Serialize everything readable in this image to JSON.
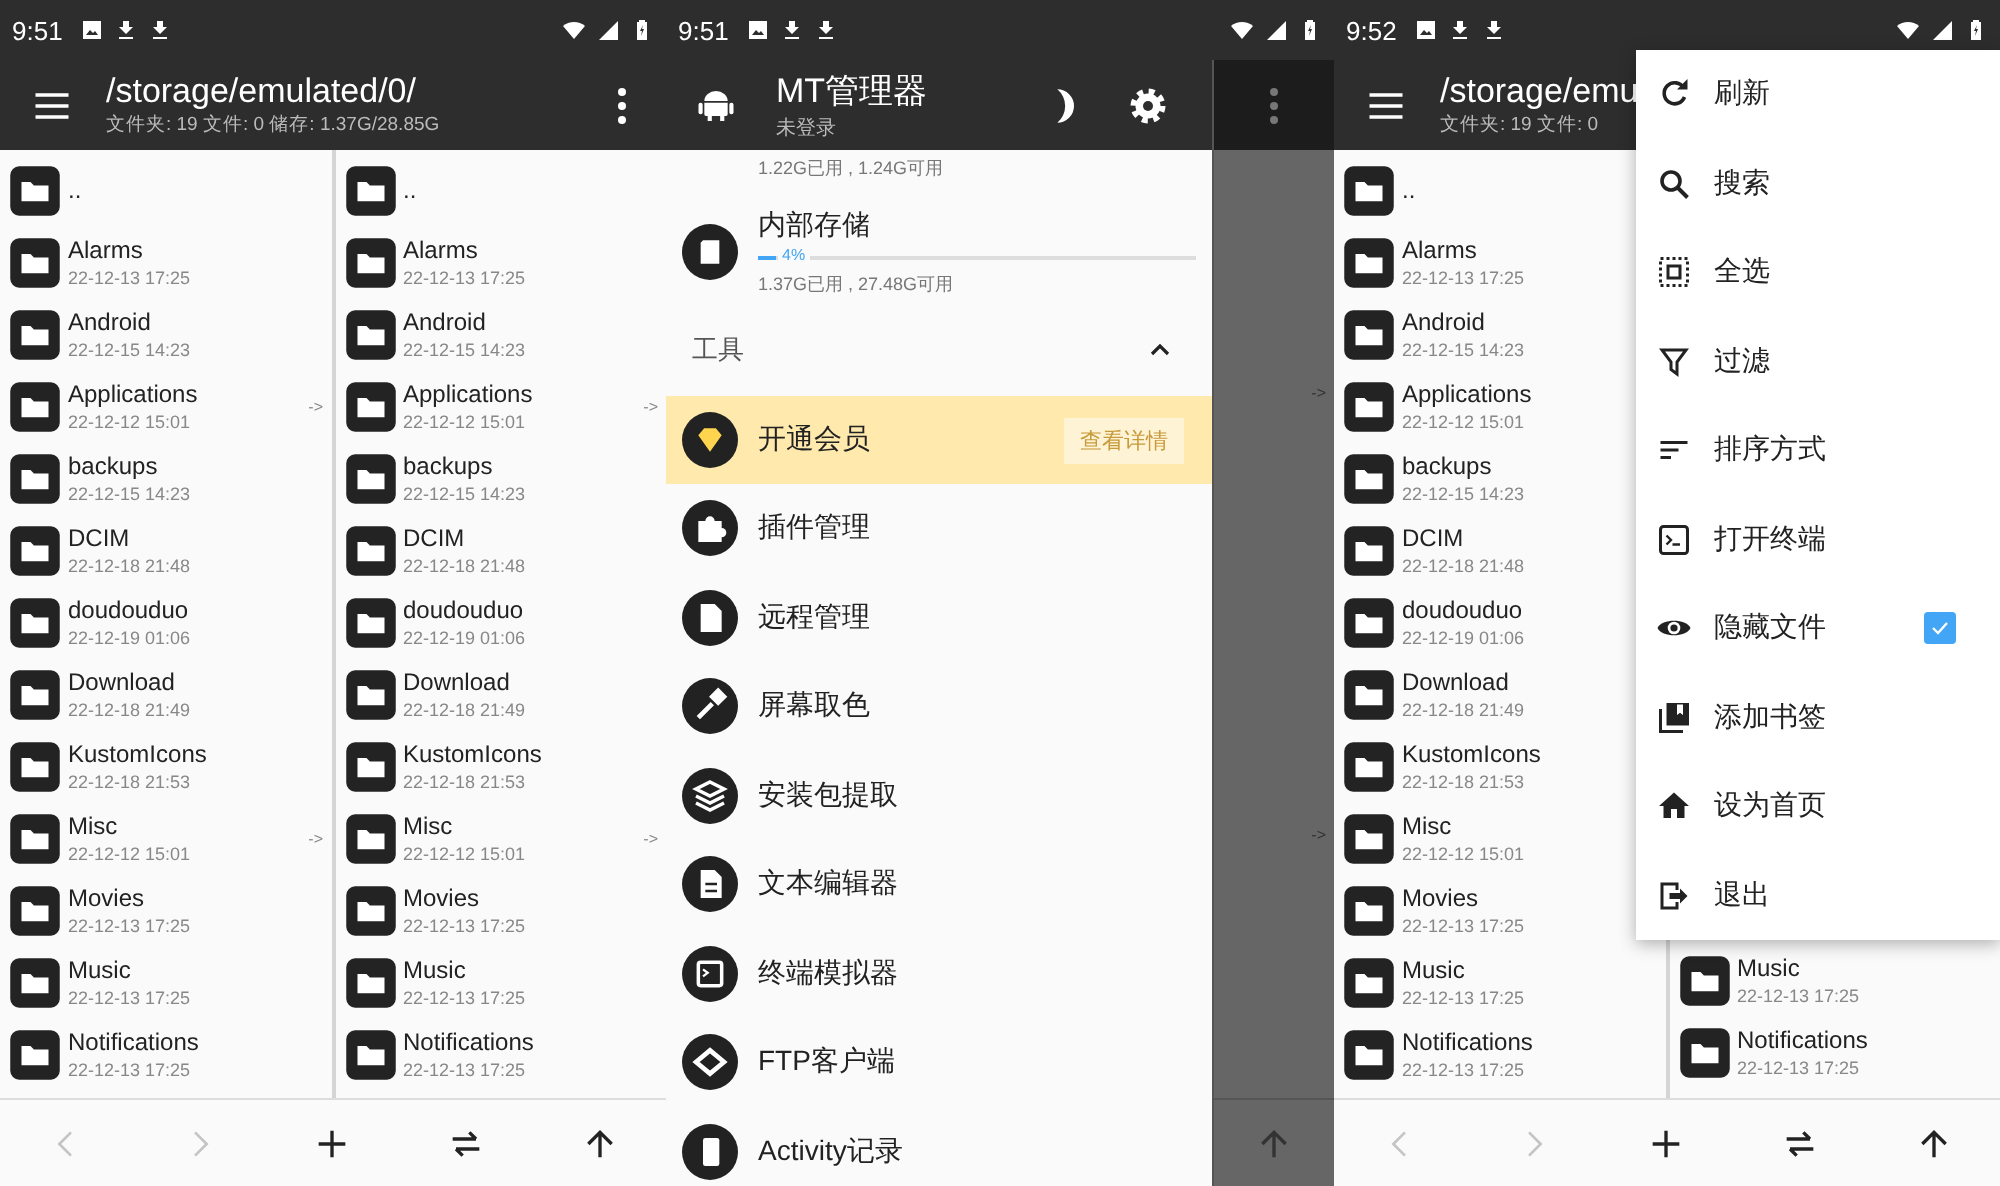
{
  "phones": [
    {
      "kind": "file_manager",
      "status_bar": {
        "time": "9:51"
      },
      "app_bar": {
        "path": "/storage/emulated/0/",
        "info": "文件夹: 19  文件: 0  储存: 1.37G/28.85G"
      },
      "panes": [
        {
          "items": [
            {
              "name": ".."
            },
            {
              "name": "Alarms",
              "date": "22-12-13 17:25"
            },
            {
              "name": "Android",
              "date": "22-12-15 14:23"
            },
            {
              "name": "Applications",
              "date": "22-12-12 15:01",
              "arrow": "->"
            },
            {
              "name": "backups",
              "date": "22-12-15 14:23"
            },
            {
              "name": "DCIM",
              "date": "22-12-18 21:48"
            },
            {
              "name": "doudouduo",
              "date": "22-12-19 01:06"
            },
            {
              "name": "Download",
              "date": "22-12-18 21:49"
            },
            {
              "name": "KustomIcons",
              "date": "22-12-18 21:53"
            },
            {
              "name": "Misc",
              "date": "22-12-12 15:01",
              "arrow": "->"
            },
            {
              "name": "Movies",
              "date": "22-12-13 17:25"
            },
            {
              "name": "Music",
              "date": "22-12-13 17:25"
            },
            {
              "name": "Notifications",
              "date": "22-12-13 17:25"
            }
          ]
        },
        {
          "items": [
            {
              "name": ".."
            },
            {
              "name": "Alarms",
              "date": "22-12-13 17:25"
            },
            {
              "name": "Android",
              "date": "22-12-15 14:23"
            },
            {
              "name": "Applications",
              "date": "22-12-12 15:01",
              "arrow": "->"
            },
            {
              "name": "backups",
              "date": "22-12-15 14:23"
            },
            {
              "name": "DCIM",
              "date": "22-12-18 21:48"
            },
            {
              "name": "doudouduo",
              "date": "22-12-19 01:06"
            },
            {
              "name": "Download",
              "date": "22-12-18 21:49"
            },
            {
              "name": "KustomIcons",
              "date": "22-12-18 21:53"
            },
            {
              "name": "Misc",
              "date": "22-12-12 15:01",
              "arrow": "->"
            },
            {
              "name": "Movies",
              "date": "22-12-13 17:25"
            },
            {
              "name": "Music",
              "date": "22-12-13 17:25"
            },
            {
              "name": "Notifications",
              "date": "22-12-13 17:25"
            }
          ]
        }
      ],
      "bottom_bar": [
        {
          "kind": "back",
          "disabled": true
        },
        {
          "kind": "forward",
          "disabled": true
        },
        {
          "kind": "add",
          "disabled": false
        },
        {
          "kind": "swap",
          "disabled": false
        },
        {
          "kind": "up",
          "disabled": false
        }
      ]
    },
    {
      "kind": "drawer",
      "status_bar": {
        "time": "9:51"
      },
      "header": {
        "title": "MT管理器",
        "subtitle": "未登录"
      },
      "storage": [
        {
          "usage": "1.22G已用 , 1.24G可用"
        },
        {
          "name": "内部存储",
          "percent": "4%",
          "level": 0.04,
          "usage": "1.37G已用 , 27.48G可用"
        }
      ],
      "section": {
        "title": "工具",
        "expanded": true
      },
      "promo": {
        "label": "开通会员",
        "button": "查看详情"
      },
      "tools": [
        {
          "label": "插件管理"
        },
        {
          "label": "远程管理"
        },
        {
          "label": "屏幕取色"
        },
        {
          "label": "安装包提取"
        },
        {
          "label": "文本编辑器"
        },
        {
          "label": "终端模拟器"
        },
        {
          "label": "FTP客户端"
        },
        {
          "label": "Activity记录"
        }
      ],
      "background": {
        "arrows": [
          "->",
          "->"
        ]
      }
    },
    {
      "kind": "file_manager",
      "status_bar": {
        "time": "9:52"
      },
      "app_bar": {
        "path": "/storage/emu",
        "info": "文件夹: 19  文件: 0"
      },
      "panes": [
        {
          "items": [
            {
              "name": ".."
            },
            {
              "name": "Alarms",
              "date": "22-12-13 17:25"
            },
            {
              "name": "Android",
              "date": "22-12-15 14:23"
            },
            {
              "name": "Applications",
              "date": "22-12-12 15:01"
            },
            {
              "name": "backups",
              "date": "22-12-15 14:23"
            },
            {
              "name": "DCIM",
              "date": "22-12-18 21:48"
            },
            {
              "name": "doudouduo",
              "date": "22-12-19 01:06"
            },
            {
              "name": "Download",
              "date": "22-12-18 21:49"
            },
            {
              "name": "KustomIcons",
              "date": "22-12-18 21:53"
            },
            {
              "name": "Misc",
              "date": "22-12-12 15:01"
            },
            {
              "name": "Movies",
              "date": "22-12-13 17:25"
            },
            {
              "name": "Music",
              "date": "22-12-13 17:25"
            },
            {
              "name": "Notifications",
              "date": "22-12-13 17:25"
            }
          ]
        },
        {
          "items": [
            {
              "name": "Music",
              "date": "22-12-13 17:25"
            },
            {
              "name": "Notifications",
              "date": "22-12-13 17:25"
            }
          ]
        }
      ],
      "bottom_bar": [
        {
          "kind": "back",
          "disabled": true
        },
        {
          "kind": "forward",
          "disabled": true
        },
        {
          "kind": "add",
          "disabled": false
        },
        {
          "kind": "swap",
          "disabled": false
        },
        {
          "kind": "up",
          "disabled": false
        }
      ],
      "menu": [
        {
          "kind": "action",
          "label": "刷新"
        },
        {
          "kind": "action",
          "label": "搜索"
        },
        {
          "kind": "action",
          "label": "全选"
        },
        {
          "kind": "action",
          "label": "过滤"
        },
        {
          "kind": "action",
          "label": "排序方式"
        },
        {
          "kind": "action",
          "label": "打开终端"
        },
        {
          "kind": "checkbox",
          "label": "隐藏文件",
          "checked": true
        },
        {
          "kind": "action",
          "label": "添加书签"
        },
        {
          "kind": "action",
          "label": "设为首页"
        },
        {
          "kind": "action",
          "label": "退出"
        }
      ]
    }
  ]
}
